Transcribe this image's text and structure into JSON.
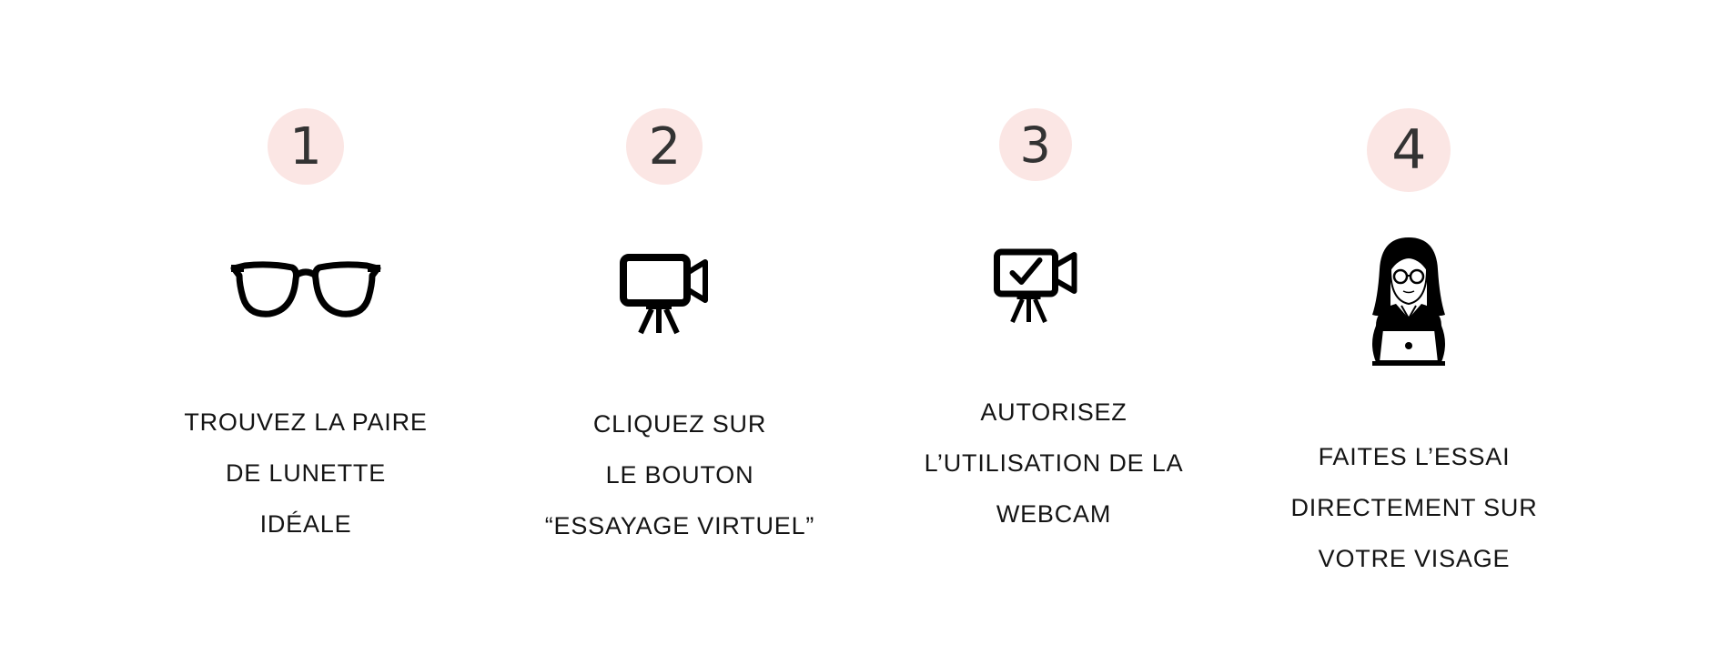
{
  "colors": {
    "badge_background": "#fbe6e4",
    "badge_text": "#333333",
    "label_text": "#141414",
    "icon": "#000000"
  },
  "steps": [
    {
      "number": "1",
      "icon": "glasses-icon",
      "lines": [
        "TROUVEZ LA PAIRE",
        "DE LUNETTE",
        "IDÉALE"
      ]
    },
    {
      "number": "2",
      "icon": "video-camera-icon",
      "lines": [
        "CLIQUEZ SUR",
        "LE BOUTON",
        "“ESSAYAGE VIRTUEL”"
      ]
    },
    {
      "number": "3",
      "icon": "webcam-check-icon",
      "lines": [
        "AUTORISEZ",
        "L’UTILISATION DE LA",
        "WEBCAM"
      ]
    },
    {
      "number": "4",
      "icon": "woman-laptop-icon",
      "lines": [
        "FAITES L’ESSAI",
        "DIRECTEMENT SUR",
        "VOTRE VISAGE"
      ]
    }
  ]
}
